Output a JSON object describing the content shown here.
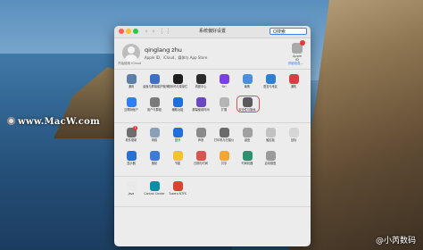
{
  "window": {
    "title": "系统偏好设置",
    "search_value": "Q搜索"
  },
  "account": {
    "name": "qinglang zhu",
    "subtitle": "Apple ID、iCloud、媒体与 App Store",
    "apple_id_label": "Apple ID",
    "icloud_text": "开始使用 iCloud",
    "details_link": "详细信息..."
  },
  "sections": [
    {
      "items": [
        {
          "label": "通用",
          "icon": "general-icon",
          "color": "#5b7fa6"
        },
        {
          "label": "桌面与屏幕保护程序",
          "icon": "desktop-icon",
          "color": "#3f6fc5"
        },
        {
          "label": "程序坞与菜单栏",
          "icon": "dock-icon",
          "color": "#1e1e1e"
        },
        {
          "label": "调度中心",
          "icon": "mission-control-icon",
          "color": "#2b2b2b"
        },
        {
          "label": "Siri",
          "icon": "siri-icon",
          "color": "#7b3fe4"
        },
        {
          "label": "聚焦",
          "icon": "spotlight-icon",
          "color": "#4a90d9"
        },
        {
          "label": "语言与地区",
          "icon": "language-icon",
          "color": "#2f7fd0"
        },
        {
          "label": "通知",
          "icon": "notifications-icon",
          "color": "#d64045"
        },
        {
          "label": "互联网帐户",
          "icon": "internet-accounts-icon",
          "color": "#2d7ff9"
        },
        {
          "label": "用户与群组",
          "icon": "users-groups-icon",
          "color": "#7a7a7a"
        },
        {
          "label": "辅助功能",
          "icon": "accessibility-icon",
          "color": "#1c6fe0"
        },
        {
          "label": "屏幕使用时间",
          "icon": "screen-time-icon",
          "color": "#6b46c1"
        },
        {
          "label": "扩展",
          "icon": "extensions-icon",
          "color": "#b5b5b5"
        },
        {
          "label": "安全性与隐私",
          "icon": "security-privacy-icon",
          "color": "#5a5a5a",
          "highlighted": true
        }
      ]
    },
    {
      "items": [
        {
          "label": "软件更新",
          "icon": "software-update-icon",
          "color": "#6f6f6f",
          "badge": "1"
        },
        {
          "label": "网络",
          "icon": "network-icon",
          "color": "#8aa0b8"
        },
        {
          "label": "蓝牙",
          "icon": "bluetooth-icon",
          "color": "#1f6fe0"
        },
        {
          "label": "声音",
          "icon": "sound-icon",
          "color": "#8a8a8a"
        },
        {
          "label": "打印机与扫描仪",
          "icon": "printer-icon",
          "color": "#6b6b6b"
        },
        {
          "label": "键盘",
          "icon": "keyboard-icon",
          "color": "#a0a0a0"
        },
        {
          "label": "触控板",
          "icon": "trackpad-icon",
          "color": "#c2c2c2"
        },
        {
          "label": "鼠标",
          "icon": "mouse-icon",
          "color": "#d6d6d6"
        },
        {
          "label": "显示器",
          "icon": "displays-icon",
          "color": "#2a6fd6"
        },
        {
          "label": "随航",
          "icon": "sidecar-icon",
          "color": "#3e7bd8"
        },
        {
          "label": "节能",
          "icon": "energy-saver-icon",
          "color": "#f2c230"
        },
        {
          "label": "日期与时间",
          "icon": "date-time-icon",
          "color": "#d9534f"
        },
        {
          "label": "共享",
          "icon": "sharing-icon",
          "color": "#f0a830"
        },
        {
          "label": "时间机器",
          "icon": "time-machine-icon",
          "color": "#2f8f6f"
        },
        {
          "label": "启动磁盘",
          "icon": "startup-disk-icon",
          "color": "#9a9a9a"
        }
      ]
    },
    {
      "items": [
        {
          "label": "Java",
          "icon": "java-icon",
          "color": "#e9e9e9"
        },
        {
          "label": "Control Center",
          "icon": "logi-icon",
          "color": "#0b8ea3"
        },
        {
          "label": "Tuxera NTFS",
          "icon": "tuxera-icon",
          "color": "#e0402f"
        }
      ]
    }
  ],
  "watermark": {
    "site": "www.MacW.com",
    "corner": "@小芮数码"
  }
}
